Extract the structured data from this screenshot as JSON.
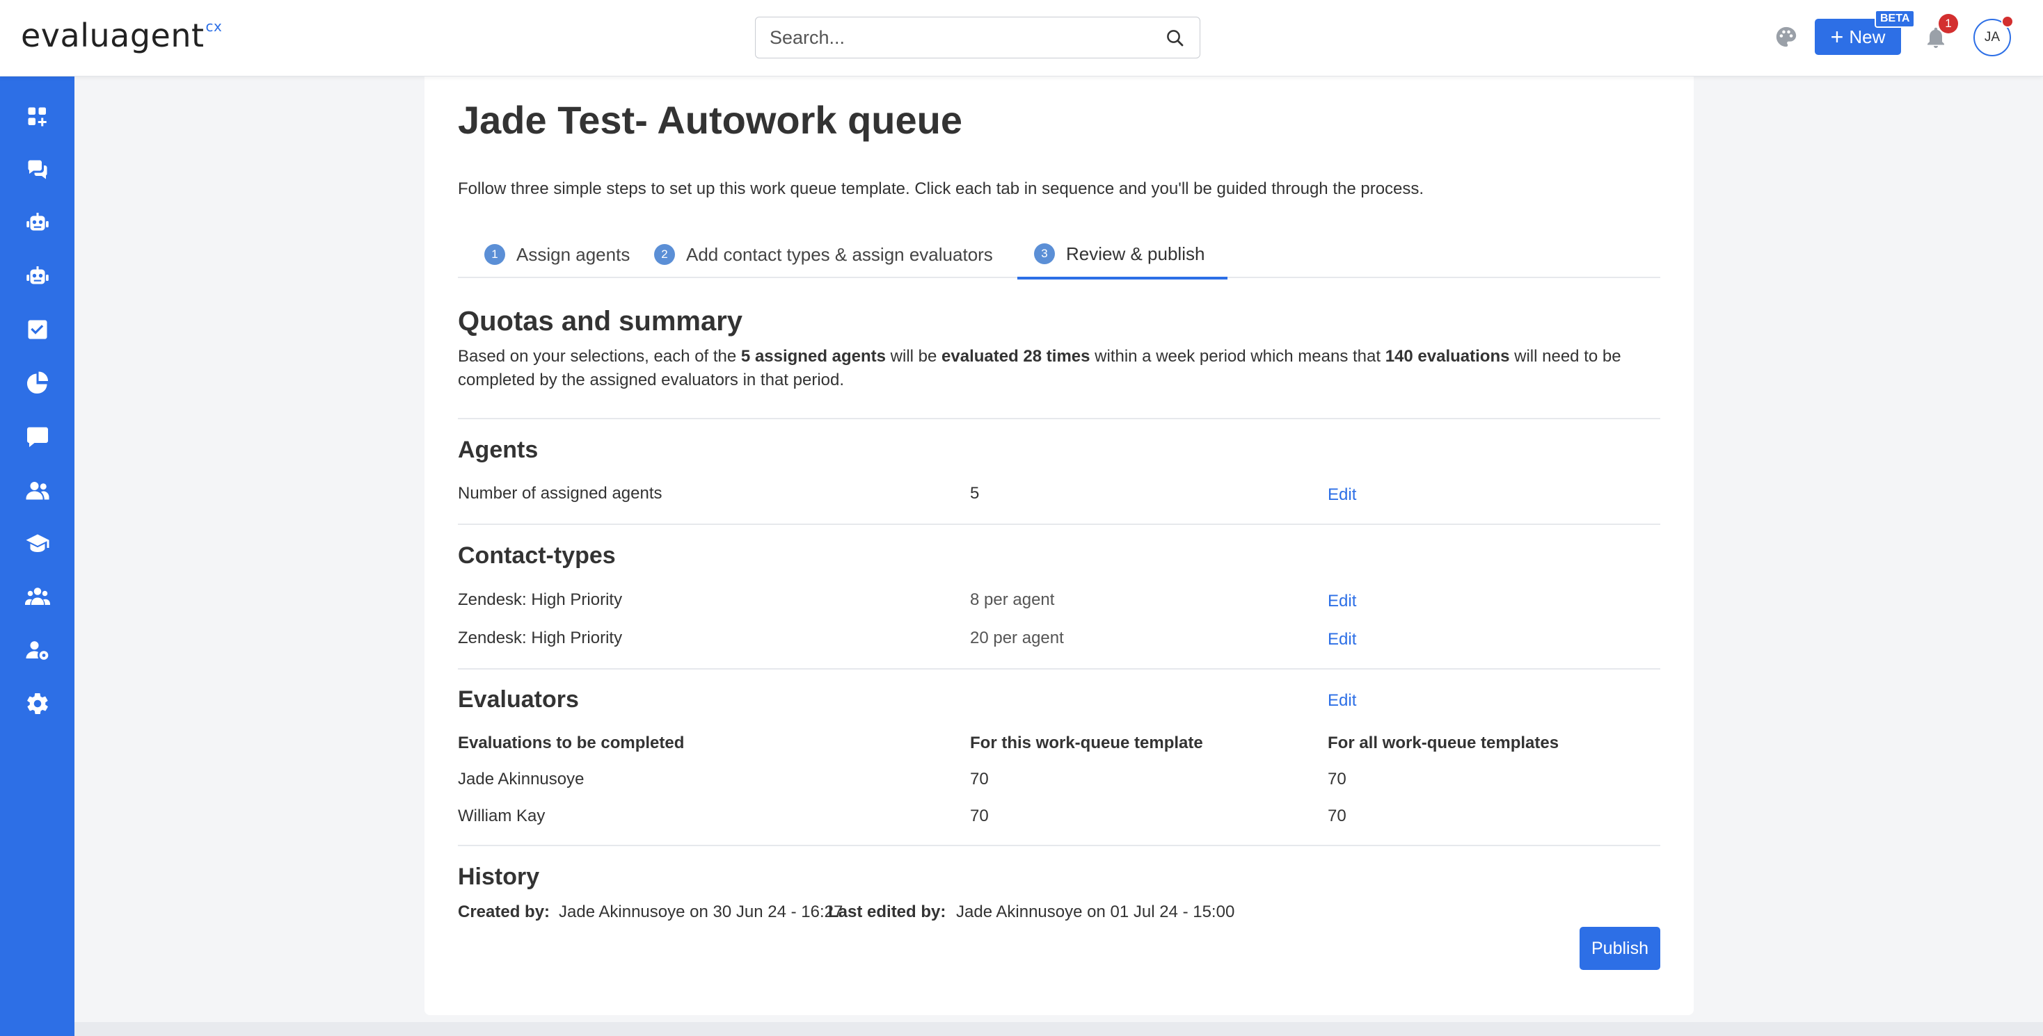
{
  "app": {
    "logo_text": "evaluagent",
    "logo_suffix": "cx"
  },
  "header": {
    "search_placeholder": "Search...",
    "new_label": "New",
    "beta_label": "BETA",
    "notification_count": "1",
    "avatar_initials": "JA"
  },
  "sidebar": {
    "items": [
      {
        "icon": "dashboard-add-icon"
      },
      {
        "icon": "conversations-icon"
      },
      {
        "icon": "robot-icon"
      },
      {
        "icon": "robot-alt-icon"
      },
      {
        "icon": "checkbox-icon"
      },
      {
        "icon": "pie-chart-icon"
      },
      {
        "icon": "comment-icon"
      },
      {
        "icon": "users-icon"
      },
      {
        "icon": "graduation-cap-icon"
      },
      {
        "icon": "team-icon"
      },
      {
        "icon": "user-settings-icon"
      },
      {
        "icon": "settings-gear-icon"
      }
    ]
  },
  "page": {
    "title": "Jade Test- Autowork queue",
    "intro": "Follow three simple steps to set up this work queue template. Click each tab in sequence and you'll be guided through the process."
  },
  "tabs": [
    {
      "num": "1",
      "label": "Assign agents"
    },
    {
      "num": "2",
      "label": "Add contact types & assign evaluators"
    },
    {
      "num": "3",
      "label": "Review & publish"
    }
  ],
  "summary": {
    "heading": "Quotas and summary",
    "t1": "Based on your selections, each of the ",
    "b1": "5 assigned agents",
    "t2": " will be ",
    "b2": "evaluated 28 times",
    "t3": " within a week period which means that ",
    "b3": "140 evaluations",
    "t4": " will need to be completed by the assigned evaluators in that period."
  },
  "agents": {
    "heading": "Agents",
    "label": "Number of assigned agents",
    "value": "5",
    "edit": "Edit"
  },
  "contact_types": {
    "heading": "Contact-types",
    "rows": [
      {
        "name": "Zendesk: High Priority",
        "quota": "8 per agent",
        "edit": "Edit"
      },
      {
        "name": "Zendesk: High Priority",
        "quota": "20 per agent",
        "edit": "Edit"
      }
    ]
  },
  "evaluators": {
    "heading": "Evaluators",
    "edit": "Edit",
    "columns": [
      "Evaluations to be completed",
      "For this work-queue template",
      "For all work-queue templates"
    ],
    "rows": [
      {
        "name": "Jade Akinnusoye",
        "this": "70",
        "all": "70"
      },
      {
        "name": "William Kay",
        "this": "70",
        "all": "70"
      }
    ]
  },
  "history": {
    "heading": "History",
    "created_label": "Created by:",
    "created_value": "Jade Akinnusoye on 30 Jun 24 - 16:27",
    "edited_label": "Last edited by:",
    "edited_value": "Jade Akinnusoye on 01 Jul 24 - 15:00"
  },
  "actions": {
    "publish": "Publish"
  },
  "colors": {
    "brand": "#2d6fe6",
    "badge": "#d32f2f"
  }
}
